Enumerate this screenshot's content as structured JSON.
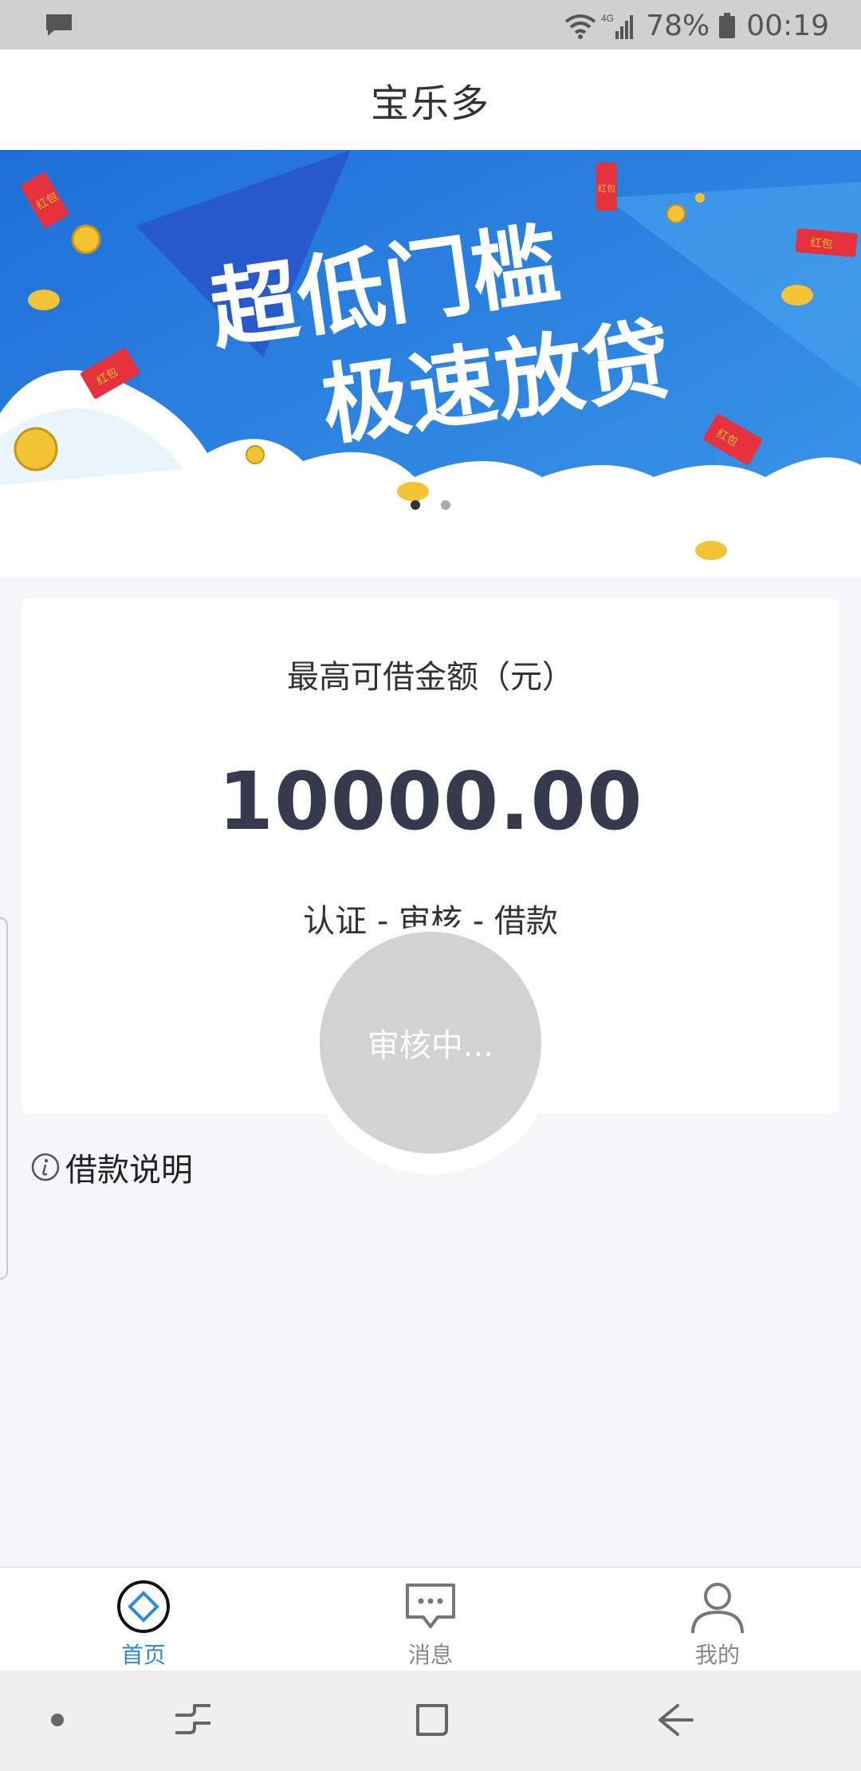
{
  "status_bar": {
    "battery_percent": "78%",
    "time": "00:19",
    "network": "4G",
    "icons": [
      "message-notification-icon",
      "wifi-icon",
      "signal-icon",
      "battery-icon"
    ]
  },
  "header": {
    "title": "宝乐多"
  },
  "banner": {
    "headline_line1": "超低门槛",
    "headline_line2": "极速放贷",
    "envelope_labels": [
      "红包",
      "红包",
      "红包",
      "红包",
      "红包"
    ],
    "slides_count": 2,
    "active_slide": 1,
    "colors": {
      "sky_blue": "#2f86e0",
      "cloud_white": "#ffffff",
      "envelope_red": "#e5323c",
      "coin_gold": "#f3c336"
    }
  },
  "loan_card": {
    "label": "最高可借金额（元）",
    "amount": "10000.00",
    "steps": "认证 - 审核 - 借款"
  },
  "review_button": {
    "label": "审核中..."
  },
  "loan_info": {
    "label": "借款说明"
  },
  "tabbar": {
    "tabs": [
      {
        "label": "首页",
        "icon": "home-diamond-icon",
        "active": true
      },
      {
        "label": "消息",
        "icon": "message-bubble-icon",
        "active": false
      },
      {
        "label": "我的",
        "icon": "person-icon",
        "active": false
      }
    ],
    "active_color": "#2a8be0"
  },
  "system_nav": {
    "icons": [
      "nav-dot-icon",
      "recent-apps-icon",
      "home-square-icon",
      "back-arrow-icon"
    ]
  }
}
